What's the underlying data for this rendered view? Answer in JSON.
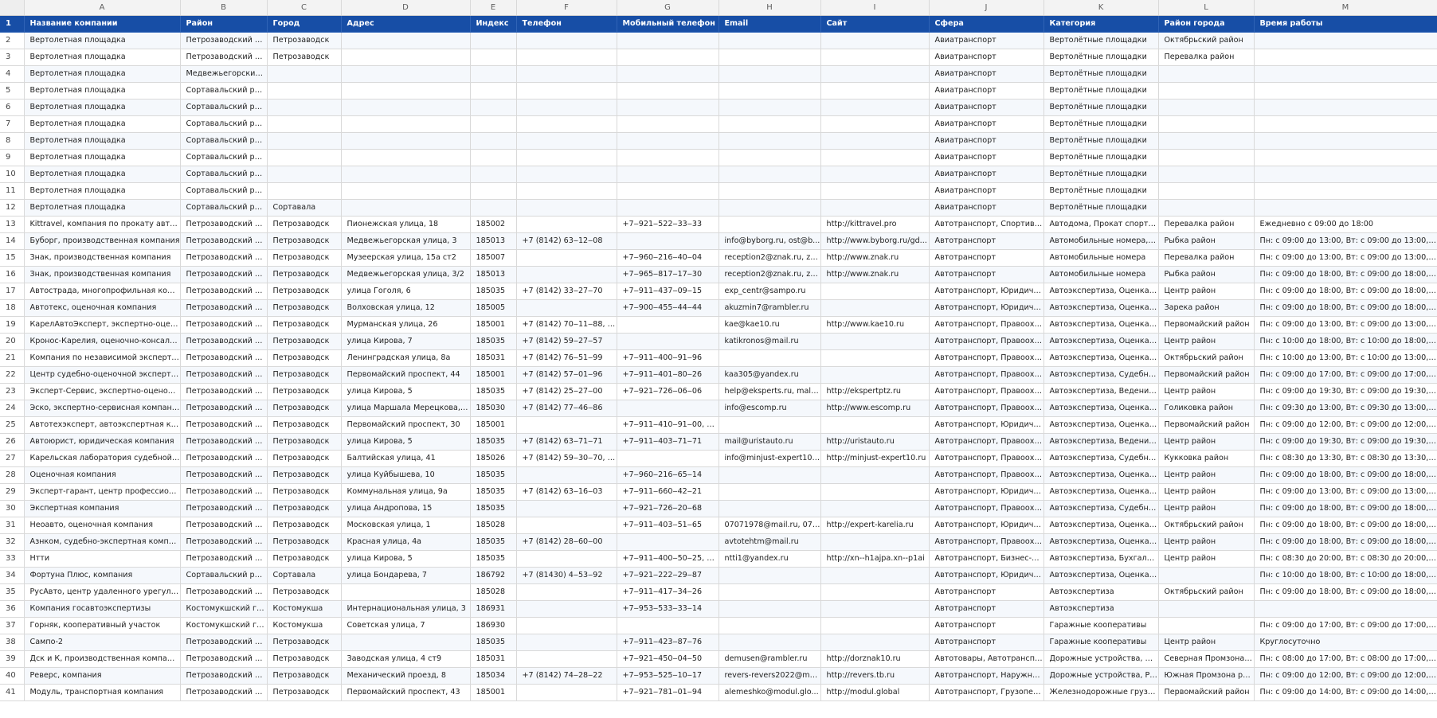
{
  "column_letters": [
    "A",
    "B",
    "C",
    "D",
    "E",
    "F",
    "G",
    "H",
    "I",
    "J",
    "K",
    "L",
    "M"
  ],
  "header": {
    "row_number": "1",
    "cells": [
      "Название компании",
      "Район",
      "Город",
      "Адрес",
      "Индекс",
      "Телефон",
      "Мобильный телефон",
      "Email",
      "Сайт",
      "Сфера",
      "Категория",
      "Район города",
      "Время работы"
    ]
  },
  "rows": [
    {
      "n": "2",
      "c": [
        "Вертолетная площадка",
        "Петрозаводский город...",
        "Петрозаводск",
        "",
        "",
        "",
        "",
        "",
        "",
        "Авиатранспорт",
        "Вертолётные площадки",
        "Октябрьский район",
        ""
      ]
    },
    {
      "n": "3",
      "c": [
        "Вертолетная площадка",
        "Петрозаводский город...",
        "Петрозаводск",
        "",
        "",
        "",
        "",
        "",
        "",
        "Авиатранспорт",
        "Вертолётные площадки",
        "Перевалка район",
        ""
      ]
    },
    {
      "n": "4",
      "c": [
        "Вертолетная площадка",
        "Медвежьегорский рай...",
        "",
        "",
        "",
        "",
        "",
        "",
        "",
        "Авиатранспорт",
        "Вертолётные площадки",
        "",
        ""
      ]
    },
    {
      "n": "5",
      "c": [
        "Вертолетная площадка",
        "Сортавальский район",
        "",
        "",
        "",
        "",
        "",
        "",
        "",
        "Авиатранспорт",
        "Вертолётные площадки",
        "",
        ""
      ]
    },
    {
      "n": "6",
      "c": [
        "Вертолетная площадка",
        "Сортавальский район",
        "",
        "",
        "",
        "",
        "",
        "",
        "",
        "Авиатранспорт",
        "Вертолётные площадки",
        "",
        ""
      ]
    },
    {
      "n": "7",
      "c": [
        "Вертолетная площадка",
        "Сортавальский район",
        "",
        "",
        "",
        "",
        "",
        "",
        "",
        "Авиатранспорт",
        "Вертолётные площадки",
        "",
        ""
      ]
    },
    {
      "n": "8",
      "c": [
        "Вертолетная площадка",
        "Сортавальский район",
        "",
        "",
        "",
        "",
        "",
        "",
        "",
        "Авиатранспорт",
        "Вертолётные площадки",
        "",
        ""
      ]
    },
    {
      "n": "9",
      "c": [
        "Вертолетная площадка",
        "Сортавальский район",
        "",
        "",
        "",
        "",
        "",
        "",
        "",
        "Авиатранспорт",
        "Вертолётные площадки",
        "",
        ""
      ]
    },
    {
      "n": "10",
      "c": [
        "Вертолетная площадка",
        "Сортавальский район",
        "",
        "",
        "",
        "",
        "",
        "",
        "",
        "Авиатранспорт",
        "Вертолётные площадки",
        "",
        ""
      ]
    },
    {
      "n": "11",
      "c": [
        "Вертолетная площадка",
        "Сортавальский район",
        "",
        "",
        "",
        "",
        "",
        "",
        "",
        "Авиатранспорт",
        "Вертолётные площадки",
        "",
        ""
      ]
    },
    {
      "n": "12",
      "c": [
        "Вертолетная площадка",
        "Сортавальский район",
        "Сортавала",
        "",
        "",
        "",
        "",
        "",
        "",
        "Авиатранспорт",
        "Вертолётные площадки",
        "",
        ""
      ]
    },
    {
      "n": "13",
      "c": [
        "Kittravel, компания по прокату автодо...",
        "Петрозаводский город...",
        "Петрозаводск",
        "Пионежская улица, 18",
        "185002",
        "",
        "+7‒921‒522‒33‒33",
        "",
        "http://kittravel.pro",
        "Автотранспорт, Спортивн...",
        "Автодома, Прокат спортив...",
        "Перевалка район",
        "Ежедневно с 09:00 до 18:00"
      ]
    },
    {
      "n": "14",
      "c": [
        "Буборг, производственная компания",
        "Петрозаводский город...",
        "Петрозаводск",
        "Медвежьегорская улица, 3",
        "185013",
        "+7 (8142) 63‒12‒08",
        "",
        "info@byborg.ru, ost@b...",
        "http://www.byborg.ru/gd...",
        "Автотранспорт",
        "Автомобильные номера, ...",
        "Рыбка район",
        "Пн: с 09:00 до 13:00, Вт: с 09:00 до 13:00, С..."
      ]
    },
    {
      "n": "15",
      "c": [
        "Знак, производственная компания",
        "Петрозаводский город...",
        "Петрозаводск",
        "Музеерская улица, 15а ст2",
        "185007",
        "",
        "+7‒960‒216‒40‒04",
        "reception2@znak.ru, za...",
        "http://www.znak.ru",
        "Автотранспорт",
        "Автомобильные номера",
        "Перевалка район",
        "Пн: с 09:00 до 13:00, Вт: с 09:00 до 13:00, С..."
      ]
    },
    {
      "n": "16",
      "c": [
        "Знак, производственная компания",
        "Петрозаводский город...",
        "Петрозаводск",
        "Медвежьегорская улица, 3/2",
        "185013",
        "",
        "+7‒965‒817‒17‒30",
        "reception2@znak.ru, za...",
        "http://www.znak.ru",
        "Автотранспорт",
        "Автомобильные номера",
        "Рыбка район",
        "Пн: с 09:00 до 18:00, Вт: с 09:00 до 18:00, С..."
      ]
    },
    {
      "n": "17",
      "c": [
        "Автострада, многопрофильная компа...",
        "Петрозаводский город...",
        "Петрозаводск",
        "улица Гоголя, 6",
        "185035",
        "+7 (8142) 33‒27‒70",
        "+7‒911‒437‒09‒15",
        "exp_centr@sampo.ru",
        "",
        "Автотранспорт, Юридичес...",
        "Автоэкспертиза, Оценка с...",
        "Центр район",
        "Пн: с 09:00 до 18:00, Вт: с 09:00 до 18:00, С..."
      ]
    },
    {
      "n": "18",
      "c": [
        "Автотекс, оценочная компания",
        "Петрозаводский город...",
        "Петрозаводск",
        "Волховская улица, 12",
        "185005",
        "",
        "+7‒900‒455‒44‒44",
        "akuzmin7@rambler.ru",
        "",
        "Автотранспорт, Юридичес...",
        "Автоэкспертиза, Оценка с...",
        "Зарека район",
        "Пн: с 09:00 до 18:00, Вт: с 09:00 до 18:00, С..."
      ]
    },
    {
      "n": "19",
      "c": [
        "КарелАвтоЭксперт, экспертно-оцено...",
        "Петрозаводский город...",
        "Петрозаводск",
        "Мурманская улица, 26",
        "185001",
        "+7 (8142) 70‒11‒88, +7...",
        "",
        "kae@kae10.ru",
        "http://www.kae10.ru",
        "Автотранспорт, Правоохр...",
        "Автоэкспертиза, Оценка с...",
        "Первомайский район",
        "Пн: с 09:00 до 13:00, Вт: с 09:00 до 13:00, С..."
      ]
    },
    {
      "n": "20",
      "c": [
        "Кронос-Карелия, оценочно-консалти...",
        "Петрозаводский город...",
        "Петрозаводск",
        "улица Кирова, 7",
        "185035",
        "+7 (8142) 59‒27‒57",
        "",
        "katikronos@mail.ru",
        "",
        "Автотранспорт, Правоохр...",
        "Автоэкспертиза, Оценка с...",
        "Центр район",
        "Пн: с 10:00 до 18:00, Вт: с 10:00 до 18:00, С..."
      ]
    },
    {
      "n": "21",
      "c": [
        "Компания по независимой экспертиз...",
        "Петрозаводский город...",
        "Петрозаводск",
        "Ленинградская улица, 8а",
        "185031",
        "+7 (8142) 76‒51‒99",
        "+7‒911‒400‒91‒96",
        "",
        "",
        "Автотранспорт, Правоохр...",
        "Автоэкспертиза, Оценка с...",
        "Октябрьский район",
        "Пн: с 10:00 до 13:00, Вт: с 10:00 до 13:00, С..."
      ]
    },
    {
      "n": "22",
      "c": [
        "Центр судебно-оценочной экспертизы",
        "Петрозаводский город...",
        "Петрозаводск",
        "Первомайский проспект, 44",
        "185001",
        "+7 (8142) 57‒01‒96",
        "+7‒911‒401‒80‒26",
        "kaa305@yandex.ru",
        "",
        "Автотранспорт, Правоохр...",
        "Автоэкспертиза, Судебная ...",
        "Первомайский район",
        "Пн: с 09:00 до 17:00, Вт: с 09:00 до 17:00, С..."
      ]
    },
    {
      "n": "23",
      "c": [
        "Эксперт-Сервис, экспертно-оценочна...",
        "Петрозаводский город...",
        "Петрозаводск",
        "улица Кирова, 5",
        "185035",
        "+7 (8142) 25‒27‒00",
        "+7‒921‒726‒06‒06",
        "help@eksperts.ru, mala...",
        "http://ekspertptz.ru",
        "Автотранспорт, Правоохр...",
        "Автоэкспертиза, Ведение ...",
        "Центр район",
        "Пн: с 09:00 до 19:30, Вт: с 09:00 до 19:30, С..."
      ]
    },
    {
      "n": "24",
      "c": [
        "Эско, экспертно-сервисная компания",
        "Петрозаводский город...",
        "Петрозаводск",
        "улица Маршала Мерецкова, 8Б",
        "185030",
        "+7 (8142) 77‒46‒86",
        "",
        "info@escomp.ru",
        "http://www.escomp.ru",
        "Автотранспорт, Правоохр...",
        "Автоэкспертиза, Оценка с...",
        "Голиковка район",
        "Пн: с 09:30 до 13:00, Вт: с 09:30 до 13:00, С..."
      ]
    },
    {
      "n": "25",
      "c": [
        "Автотехэксперт, автоэкспертная комп...",
        "Петрозаводский город...",
        "Петрозаводск",
        "Первомайский проспект, 30",
        "185001",
        "",
        "+7‒911‒410‒91‒00, +7...",
        "",
        "",
        "Автотранспорт, Юридичес...",
        "Автоэкспертиза, Оценка с...",
        "Первомайский район",
        "Пн: с 09:00 до 12:00, Вт: с 09:00 до 12:00, С..."
      ]
    },
    {
      "n": "26",
      "c": [
        "Автоюрист, юридическая компания",
        "Петрозаводский город...",
        "Петрозаводск",
        "улица Кирова, 5",
        "185035",
        "+7 (8142) 63‒71‒71",
        "+7‒911‒403‒71‒71",
        "mail@uristauto.ru",
        "http://uristauto.ru",
        "Автотранспорт, Правоохр...",
        "Автоэкспертиза, Ведение ...",
        "Центр район",
        "Пн: с 09:00 до 19:30, Вт: с 09:00 до 19:30, С..."
      ]
    },
    {
      "n": "27",
      "c": [
        "Карельская лаборатория судебной эк...",
        "Петрозаводский город...",
        "Петрозаводск",
        "Балтийская улица, 41",
        "185026",
        "+7 (8142) 59‒30‒70, +7...",
        "",
        "info@minjust-expert10....",
        "http://minjust-expert10.ru",
        "Автотранспорт, Правоохр...",
        "Автоэкспертиза, Судебная ...",
        "Кукковка район",
        "Пн: с 08:30 до 13:30, Вт: с 08:30 до 13:30, С..."
      ]
    },
    {
      "n": "28",
      "c": [
        "Оценочная компания",
        "Петрозаводский город...",
        "Петрозаводск",
        "улица Куйбышева, 10",
        "185035",
        "",
        "+7‒960‒216‒65‒14",
        "",
        "",
        "Автотранспорт, Правоохр...",
        "Автоэкспертиза, Оценка с...",
        "Центр район",
        "Пн: с 09:00 до 18:00, Вт: с 09:00 до 18:00, С..."
      ]
    },
    {
      "n": "29",
      "c": [
        "Эксперт-гарант, центр профессионал...",
        "Петрозаводский город...",
        "Петрозаводск",
        "Коммунальная улица, 9а",
        "185035",
        "+7 (8142) 63‒16‒03",
        "+7‒911‒660‒42‒21",
        "",
        "",
        "Автотранспорт, Юридичес...",
        "Автоэкспертиза, Оценка с...",
        "Центр район",
        "Пн: с 09:00 до 13:00, Вт: с 09:00 до 13:00, С..."
      ]
    },
    {
      "n": "30",
      "c": [
        "Экспертная компания",
        "Петрозаводский город...",
        "Петрозаводск",
        "улица Андропова, 15",
        "185035",
        "",
        "+7‒921‒726‒20‒68",
        "",
        "",
        "Автотранспорт, Правоохр...",
        "Автоэкспертиза, Судебная ...",
        "Центр район",
        "Пн: с 09:00 до 18:00, Вт: с 09:00 до 18:00, С..."
      ]
    },
    {
      "n": "31",
      "c": [
        "Неоавто, оценочная компания",
        "Петрозаводский город...",
        "Петрозаводск",
        "Московская улица, 1",
        "185028",
        "",
        "+7‒911‒403‒51‒65",
        "07071978@mail.ru, 070...",
        "http://expert-karelia.ru",
        "Автотранспорт, Юридичес...",
        "Автоэкспертиза, Оценка с...",
        "Октябрьский район",
        "Пн: с 09:00 до 18:00, Вт: с 09:00 до 18:00, С..."
      ]
    },
    {
      "n": "32",
      "c": [
        "Азнком, судебно-экспертная компания",
        "Петрозаводский город...",
        "Петрозаводск",
        "Красная улица, 4а",
        "185035",
        "+7 (8142) 28‒60‒00",
        "",
        "avtotehtm@mail.ru",
        "",
        "Автотранспорт, Правоохр...",
        "Автоэкспертиза, Оценка с...",
        "Центр район",
        "Пн: с 09:00 до 18:00, Вт: с 09:00 до 18:00, С..."
      ]
    },
    {
      "n": "33",
      "c": [
        "Нтти",
        "Петрозаводский город...",
        "Петрозаводск",
        "улица Кирова, 5",
        "185035",
        "",
        "+7‒911‒400‒50‒25, +7...",
        "ntti1@yandex.ru",
        "http://xn--h1ajpa.xn--p1ai",
        "Автотранспорт, Бизнес-ус...",
        "Автоэкспертиза, Бухгалтер...",
        "Центр район",
        "Пн: с 08:30 до 20:00, Вт: с 08:30 до 20:00, С..."
      ]
    },
    {
      "n": "34",
      "c": [
        "Фортуна Плюс, компания",
        "Сортавальский район",
        "Сортавала",
        "улица Бондарева, 7",
        "186792",
        "+7 (81430) 4‒53‒92",
        "+7‒921‒222‒29‒87",
        "",
        "",
        "Автотранспорт, Юридичес...",
        "Автоэкспертиза, Оценка с...",
        "",
        "Пн: с 10:00 до 18:00, Вт: с 10:00 до 18:00, С..."
      ]
    },
    {
      "n": "35",
      "c": [
        "РусАвто, центр удаленного урегулиро...",
        "Петрозаводский город...",
        "Петрозаводск",
        "",
        "185028",
        "",
        "+7‒911‒417‒34‒26",
        "",
        "",
        "Автотранспорт",
        "Автоэкспертиза",
        "Октябрьский район",
        "Пн: с 09:00 до 18:00, Вт: с 09:00 до 18:00, С..."
      ]
    },
    {
      "n": "36",
      "c": [
        "Компания госавтоэкспертизы",
        "Костомукшский городс...",
        "Костомукша",
        "Интернациональная улица, 3",
        "186931",
        "",
        "+7‒953‒533‒33‒14",
        "",
        "",
        "Автотранспорт",
        "Автоэкспертиза",
        "",
        ""
      ]
    },
    {
      "n": "37",
      "c": [
        "Горняк, кооперативный участок",
        "Костомукшский городс...",
        "Костомукша",
        "Советская улица, 7",
        "186930",
        "",
        "",
        "",
        "",
        "Автотранспорт",
        "Гаражные кооперативы",
        "",
        "Пн: с 09:00 до 17:00, Вт: с 09:00 до 17:00, С..."
      ]
    },
    {
      "n": "38",
      "c": [
        "Сампо-2",
        "Петрозаводский город...",
        "Петрозаводск",
        "",
        "185035",
        "",
        "+7‒911‒423‒87‒76",
        "",
        "",
        "Автотранспорт",
        "Гаражные кооперативы",
        "Центр район",
        "Круглосуточно"
      ]
    },
    {
      "n": "39",
      "c": [
        "Дск и К, производственная компания",
        "Петрозаводский город...",
        "Петрозаводск",
        "Заводская улица, 4 ст9",
        "185031",
        "",
        "+7‒921‒450‒04‒50",
        "demusen@rambler.ru",
        "http://dorznak10.ru",
        "Автотовары, Автотранспорт",
        "Дорожные устройства, Св...",
        "Северная Промзона ...",
        "Пн: с 08:00 до 17:00, Вт: с 08:00 до 17:00, С..."
      ]
    },
    {
      "n": "40",
      "c": [
        "Реверс, компания",
        "Петрозаводский город...",
        "Петрозаводск",
        "Механический проезд, 8",
        "185034",
        "+7 (8142) 74‒28‒22",
        "+7‒953‒525‒10‒17",
        "revers-revers2022@mail....",
        "http://revers.tb.ru",
        "Автотранспорт, Наружная ...",
        "Дорожные устройства, Раз...",
        "Южная Промзона ра...",
        "Пн: с 09:00 до 12:00, Вт: с 09:00 до 12:00, С..."
      ]
    },
    {
      "n": "41",
      "c": [
        "Модуль, транспортная компания",
        "Петрозаводский город...",
        "Петрозаводск",
        "Первомайский проспект, 43",
        "185001",
        "",
        "+7‒921‒781‒01‒94",
        "alemeshko@modul.glo...",
        "http://modul.global",
        "Автотранспорт, Грузопере...",
        "Железнодорожные грузоп...",
        "Первомайский район",
        "Пн: с 09:00 до 14:00, Вт: с 09:00 до 14:00, С..."
      ]
    }
  ]
}
